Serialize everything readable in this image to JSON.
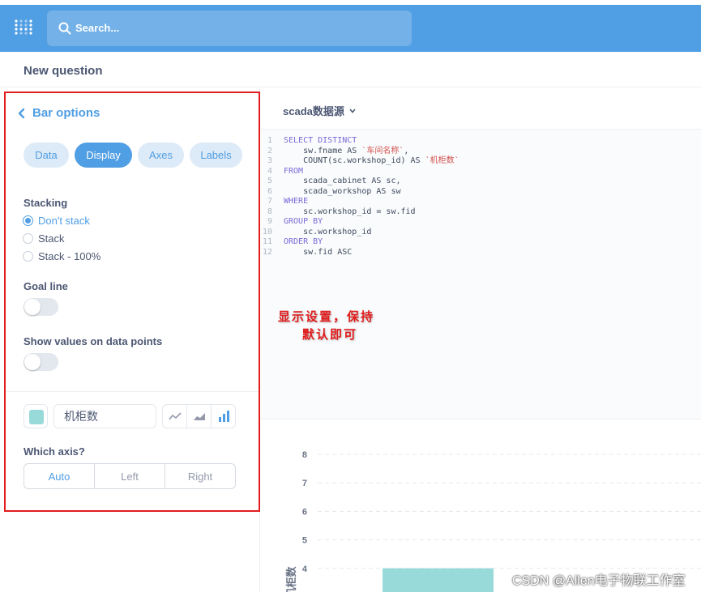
{
  "topbar": {
    "search_placeholder": "Search..."
  },
  "question": {
    "title": "New question"
  },
  "sidebar": {
    "back_label": "Bar options",
    "tabs": [
      {
        "label": "Data",
        "active": false
      },
      {
        "label": "Display",
        "active": true
      },
      {
        "label": "Axes",
        "active": false
      },
      {
        "label": "Labels",
        "active": false
      }
    ],
    "stacking": {
      "label": "Stacking",
      "options": [
        {
          "label": "Don't stack",
          "selected": true
        },
        {
          "label": "Stack",
          "selected": false
        },
        {
          "label": "Stack - 100%",
          "selected": false
        }
      ]
    },
    "goal_line": {
      "label": "Goal line",
      "on": false
    },
    "show_values": {
      "label": "Show values on data points",
      "on": false
    },
    "series": {
      "color": "#98d9d9",
      "name": "机柜数",
      "chart_types": [
        "line",
        "area",
        "bar"
      ],
      "active_chart_type": "bar"
    },
    "which_axis": {
      "label": "Which axis?",
      "options": [
        "Auto",
        "Left",
        "Right"
      ],
      "active": "Auto"
    }
  },
  "main": {
    "database": "scada数据源",
    "sql_lines": [
      {
        "n": "1",
        "text": "SELECT DISTINCT"
      },
      {
        "n": "2",
        "text": "    sw.fname AS `车间名称`,"
      },
      {
        "n": "3",
        "text": "    COUNT(sc.workshop_id) AS `机柜数`"
      },
      {
        "n": "4",
        "text": "FROM"
      },
      {
        "n": "5",
        "text": "    scada_cabinet AS sc,"
      },
      {
        "n": "6",
        "text": "    scada_workshop AS sw"
      },
      {
        "n": "7",
        "text": "WHERE"
      },
      {
        "n": "8",
        "text": "    sc.workshop_id = sw.fid"
      },
      {
        "n": "9",
        "text": "GROUP BY"
      },
      {
        "n": "10",
        "text": "    sc.workshop_id"
      },
      {
        "n": "11",
        "text": "ORDER BY"
      },
      {
        "n": "12",
        "text": "    sw.fid ASC"
      }
    ],
    "annotation_line1": "显示设置，保持",
    "annotation_line2": "默认即可"
  },
  "chart_data": {
    "type": "bar",
    "ylabel": "机柜数",
    "y_ticks": [
      4,
      5,
      6,
      7,
      8
    ],
    "ylim": [
      3.2,
      8
    ],
    "values": [
      4
    ],
    "grid": true,
    "bar_color": "#98d9d9"
  },
  "watermark": "CSDN @Allen电子物联工作室",
  "colors": {
    "brand": "#509ee3",
    "text": "#4c5773",
    "annotation": "#e11d1d"
  }
}
